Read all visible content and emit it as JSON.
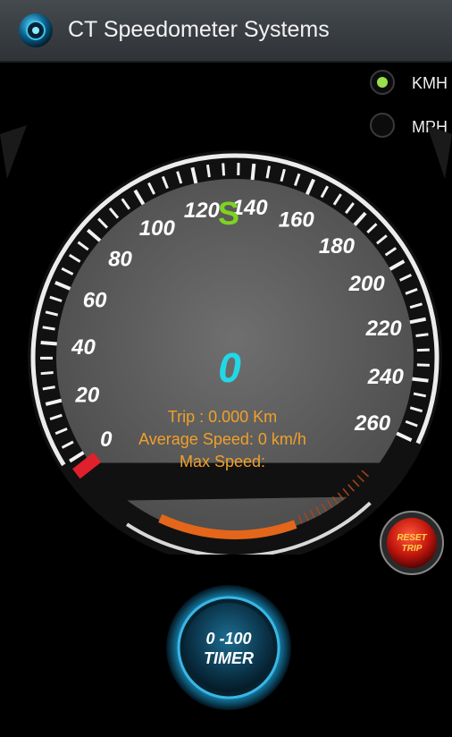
{
  "app": {
    "title": "CT Speedometer Systems"
  },
  "units": [
    {
      "label": "KMH",
      "selected": true
    },
    {
      "label": "MPH",
      "selected": false
    }
  ],
  "gauge": {
    "tick_labels": [
      "0",
      "20",
      "40",
      "60",
      "80",
      "100",
      "120",
      "140",
      "160",
      "180",
      "200",
      "220",
      "240",
      "260"
    ],
    "min": 0,
    "max": 260,
    "gear": "S",
    "speed": "0",
    "trip": "Trip : 0.000 Km",
    "average": "Average Speed: 0 km/h",
    "max_speed": "Max Speed:",
    "colors": {
      "gear": "#7ed321",
      "speed": "#22d8e6",
      "info": "#f0a02a",
      "redzone": "#e0202a"
    }
  },
  "buttons": {
    "reset_line1": "RESET",
    "reset_line2": "TRIP",
    "timer_line1": "0 -100",
    "timer_line2": "TIMER"
  }
}
